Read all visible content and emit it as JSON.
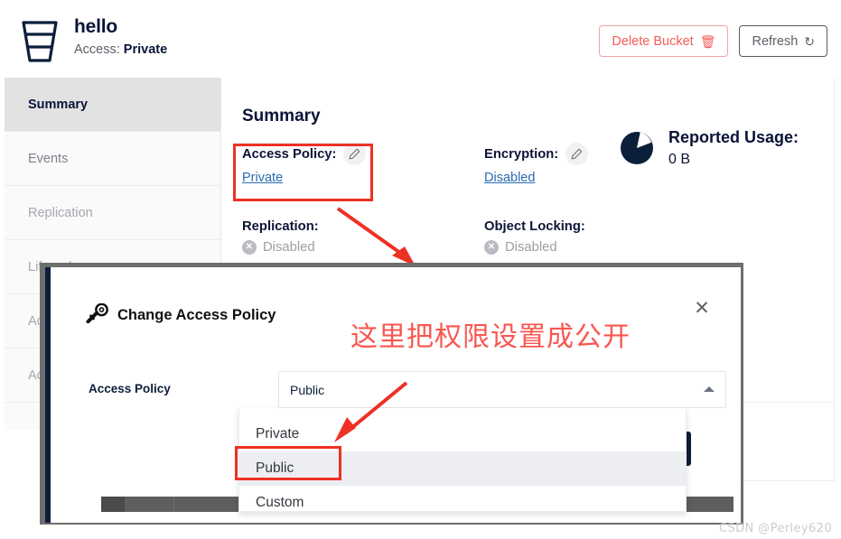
{
  "header": {
    "bucket_name": "hello",
    "access_prefix": "Access:",
    "access_value": "Private",
    "bucket_icon": "bucket-icon",
    "delete_button": "Delete Bucket",
    "delete_icon": "trash-icon",
    "refresh_button": "Refresh",
    "refresh_icon": "refresh-icon"
  },
  "sidebar": {
    "items": [
      {
        "label": "Summary",
        "state": "active"
      },
      {
        "label": "Events",
        "state": "normal"
      },
      {
        "label": "Replication",
        "state": "dim"
      },
      {
        "label": "Lifecycle",
        "state": "dim"
      },
      {
        "label": "Access Audit",
        "state": "dim"
      },
      {
        "label": "Access Rules",
        "state": "dim"
      }
    ]
  },
  "summary": {
    "title": "Summary",
    "access_policy": {
      "label": "Access Policy:",
      "value": "Private",
      "edit_icon": "pencil-icon"
    },
    "encryption": {
      "label": "Encryption:",
      "value": "Disabled",
      "edit_icon": "pencil-icon"
    },
    "replication": {
      "label": "Replication:",
      "value": "Disabled",
      "status_icon": "x-circle-icon"
    },
    "object_locking": {
      "label": "Object Locking:",
      "value": "Disabled",
      "status_icon": "x-circle-icon"
    },
    "reported_usage": {
      "label": "Reported Usage:",
      "value": "0 B",
      "chart_icon": "pie-chart-icon"
    }
  },
  "modal": {
    "title": "Change Access Policy",
    "title_icon": "key-icon",
    "close_icon": "close-icon",
    "field_label": "Access Policy",
    "select_value": "Public",
    "caret_icon": "chevron-up-icon",
    "options": [
      {
        "label": "Private",
        "selected": false
      },
      {
        "label": "Public",
        "selected": true
      },
      {
        "label": "Custom",
        "selected": false
      }
    ]
  },
  "annotations": {
    "chinese_note": "这里把权限设置成公开",
    "highlight_access_policy": "access-policy-highlight",
    "highlight_public_option": "public-option-highlight",
    "arrow_color": "#ee3124",
    "note_color": "#f9564f"
  },
  "watermark": "CSDN @Perley620",
  "colors": {
    "accent_navy": "#0b1f3a",
    "link_blue": "#2b6cb0",
    "danger_red": "#f45b5b",
    "annotation_red": "#ee3124",
    "sidebar_bg": "#fafafa",
    "sidebar_active_bg": "#e2e2e2"
  }
}
